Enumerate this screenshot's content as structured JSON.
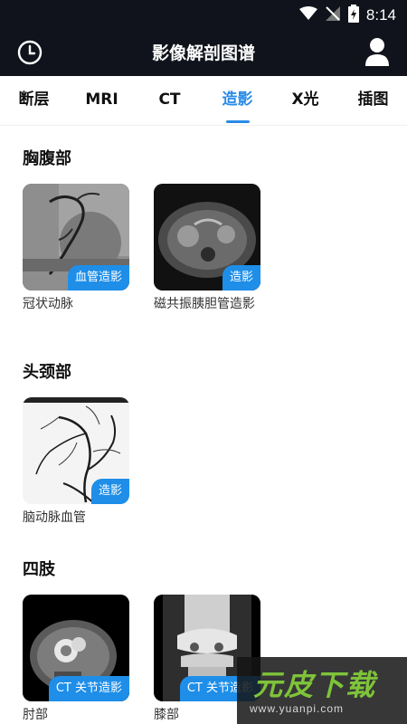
{
  "status_bar": {
    "time": "8:14"
  },
  "header": {
    "title": "影像解剖图谱"
  },
  "tabs": [
    {
      "label": "断层"
    },
    {
      "label": "MRI"
    },
    {
      "label": "CT"
    },
    {
      "label": "造影",
      "active": true
    },
    {
      "label": "X光"
    },
    {
      "label": "插图"
    }
  ],
  "sections": [
    {
      "title": "胸腹部",
      "items": [
        {
          "label": "冠状动脉",
          "badge": "血管造影"
        },
        {
          "label": "磁共振胰胆管造影",
          "badge": "造影"
        }
      ]
    },
    {
      "title": "头颈部",
      "items": [
        {
          "label": "脑动脉血管",
          "badge": "造影"
        }
      ]
    },
    {
      "title": "四肢",
      "items": [
        {
          "label": "肘部",
          "badge": "CT 关节造影"
        },
        {
          "label": "膝部",
          "badge": "CT 关节造影"
        }
      ]
    }
  ],
  "watermark": {
    "text": "元皮下载",
    "url": "www.yuanpi.com"
  },
  "colors": {
    "accent": "#2a8be6",
    "badge": "#1e8ee8",
    "header_bg": "#10131b"
  }
}
